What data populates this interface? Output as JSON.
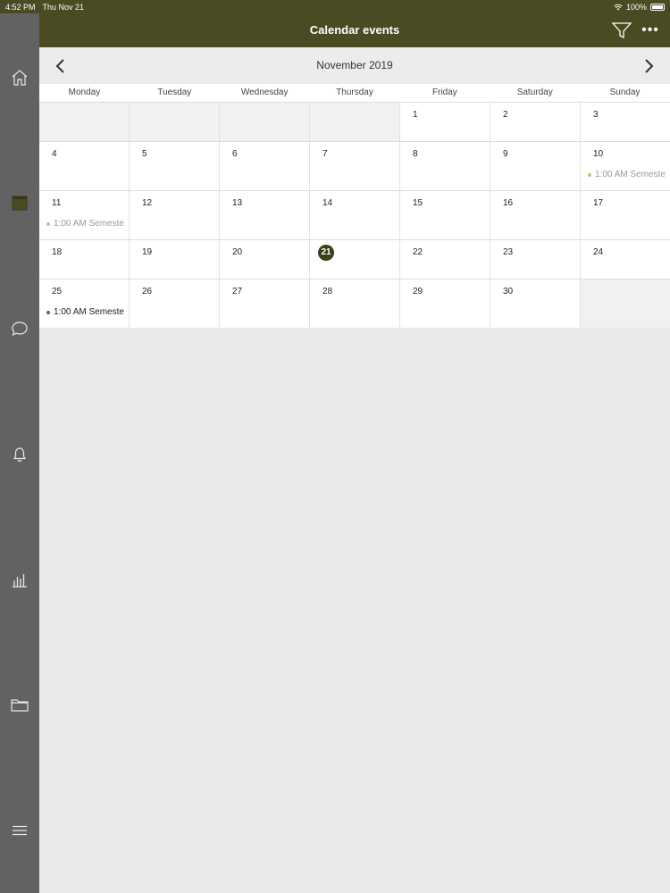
{
  "status_bar": {
    "time": "4:52 PM",
    "date": "Thu Nov 21",
    "battery": "100%"
  },
  "header": {
    "title": "Calendar events"
  },
  "month_nav": {
    "label": "November 2019"
  },
  "weekdays": [
    "Monday",
    "Tuesday",
    "Wednesday",
    "Thursday",
    "Friday",
    "Saturday",
    "Sunday"
  ],
  "weeks": [
    {
      "days": [
        {
          "day": ""
        },
        {
          "day": ""
        },
        {
          "day": ""
        },
        {
          "day": ""
        },
        {
          "day": "1"
        },
        {
          "day": "2"
        },
        {
          "day": "3"
        }
      ]
    },
    {
      "days": [
        {
          "day": "4"
        },
        {
          "day": "5"
        },
        {
          "day": "6"
        },
        {
          "day": "7"
        },
        {
          "day": "8"
        },
        {
          "day": "9"
        },
        {
          "day": "10",
          "event": "1:00 AM Semeste",
          "event_state": "past"
        }
      ]
    },
    {
      "days": [
        {
          "day": "11",
          "event": "1:00 AM Semeste",
          "event_state": "past"
        },
        {
          "day": "12"
        },
        {
          "day": "13"
        },
        {
          "day": "14"
        },
        {
          "day": "15"
        },
        {
          "day": "16"
        },
        {
          "day": "17"
        }
      ]
    },
    {
      "days": [
        {
          "day": "18"
        },
        {
          "day": "19"
        },
        {
          "day": "20"
        },
        {
          "day": "21",
          "today": true
        },
        {
          "day": "22"
        },
        {
          "day": "23"
        },
        {
          "day": "24"
        }
      ]
    },
    {
      "days": [
        {
          "day": "25",
          "event": "1:00 AM Semeste",
          "event_state": "future"
        },
        {
          "day": "26"
        },
        {
          "day": "27"
        },
        {
          "day": "28"
        },
        {
          "day": "29"
        },
        {
          "day": "30"
        },
        {
          "day": ""
        }
      ]
    }
  ],
  "sidebar": {
    "items": [
      {
        "icon": "home-icon"
      },
      {
        "icon": "calendar-icon"
      },
      {
        "icon": "chat-icon"
      },
      {
        "icon": "bell-icon"
      },
      {
        "icon": "chart-icon"
      },
      {
        "icon": "folder-icon"
      },
      {
        "icon": "menu-icon"
      }
    ]
  },
  "colors": {
    "header": "#4a4b22",
    "sidebar": "#626262",
    "today": "#3e3f1b",
    "background": "#e9e8ea"
  }
}
